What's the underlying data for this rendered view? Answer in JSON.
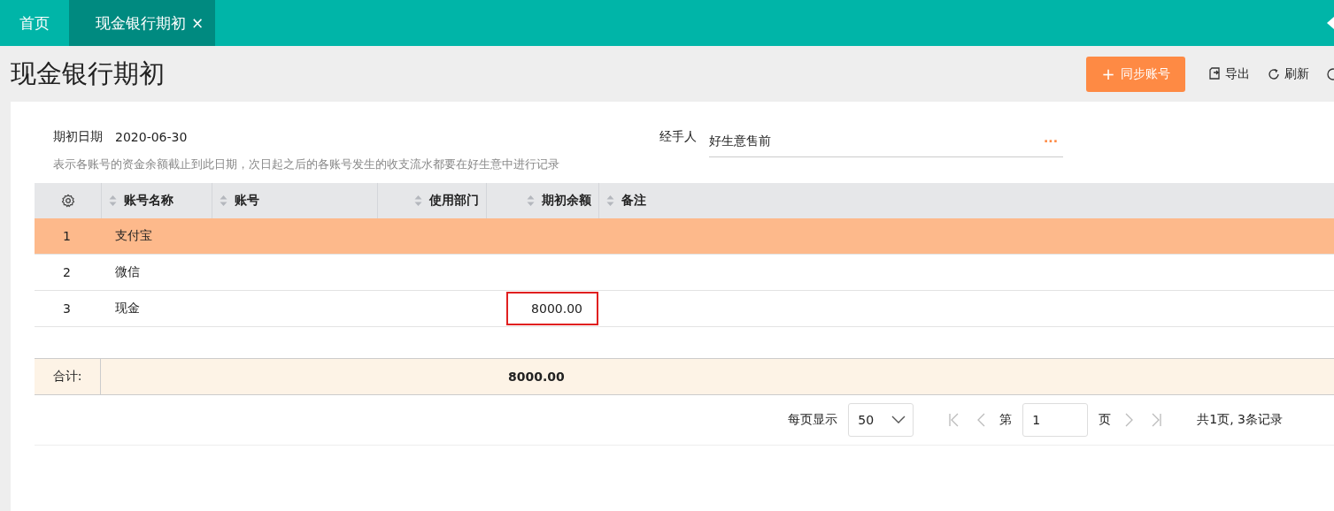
{
  "tabs": [
    {
      "label": "首页",
      "selected": false
    },
    {
      "label": "现金银行期初",
      "selected": true,
      "close_glyph": "×"
    }
  ],
  "page_title": "现金银行期初",
  "toolbar": {
    "primary_button": {
      "icon": "+",
      "label": "同步账号"
    },
    "actions": [
      {
        "kind": "export",
        "label": "导出"
      },
      {
        "kind": "refresh",
        "label": "刷新"
      }
    ]
  },
  "form": {
    "date_label": "期初日期",
    "date_value": "2020-06-30",
    "handler_label": "经手人",
    "handler_value": "好生意售前",
    "handler_more": "···",
    "hint": "表示各账号的资金余额截止到此日期，次日起之后的各账号发生的收支流水都要在好生意中进行记录"
  },
  "table": {
    "columns": [
      {
        "label": "账号名称"
      },
      {
        "label": "账号"
      },
      {
        "label": "使用部门"
      },
      {
        "label": "期初余额"
      },
      {
        "label": "备注"
      }
    ],
    "rows": [
      {
        "index": "1",
        "name": "支付宝",
        "selected": true,
        "balance_error": false
      },
      {
        "index": "2",
        "name": "微信",
        "selected": false,
        "balance_error": false
      },
      {
        "index": "3",
        "name": "现金",
        "balance": "8000.00",
        "selected": false,
        "balance_error": true
      }
    ],
    "total_label": "合计:",
    "total_balance": "8000.00"
  },
  "pagination": {
    "page_size_label": "每页显示",
    "page_size": "50",
    "page_prefix": "第",
    "page": "1",
    "page_suffix": "页",
    "summary": "共1页, 3条记录"
  }
}
